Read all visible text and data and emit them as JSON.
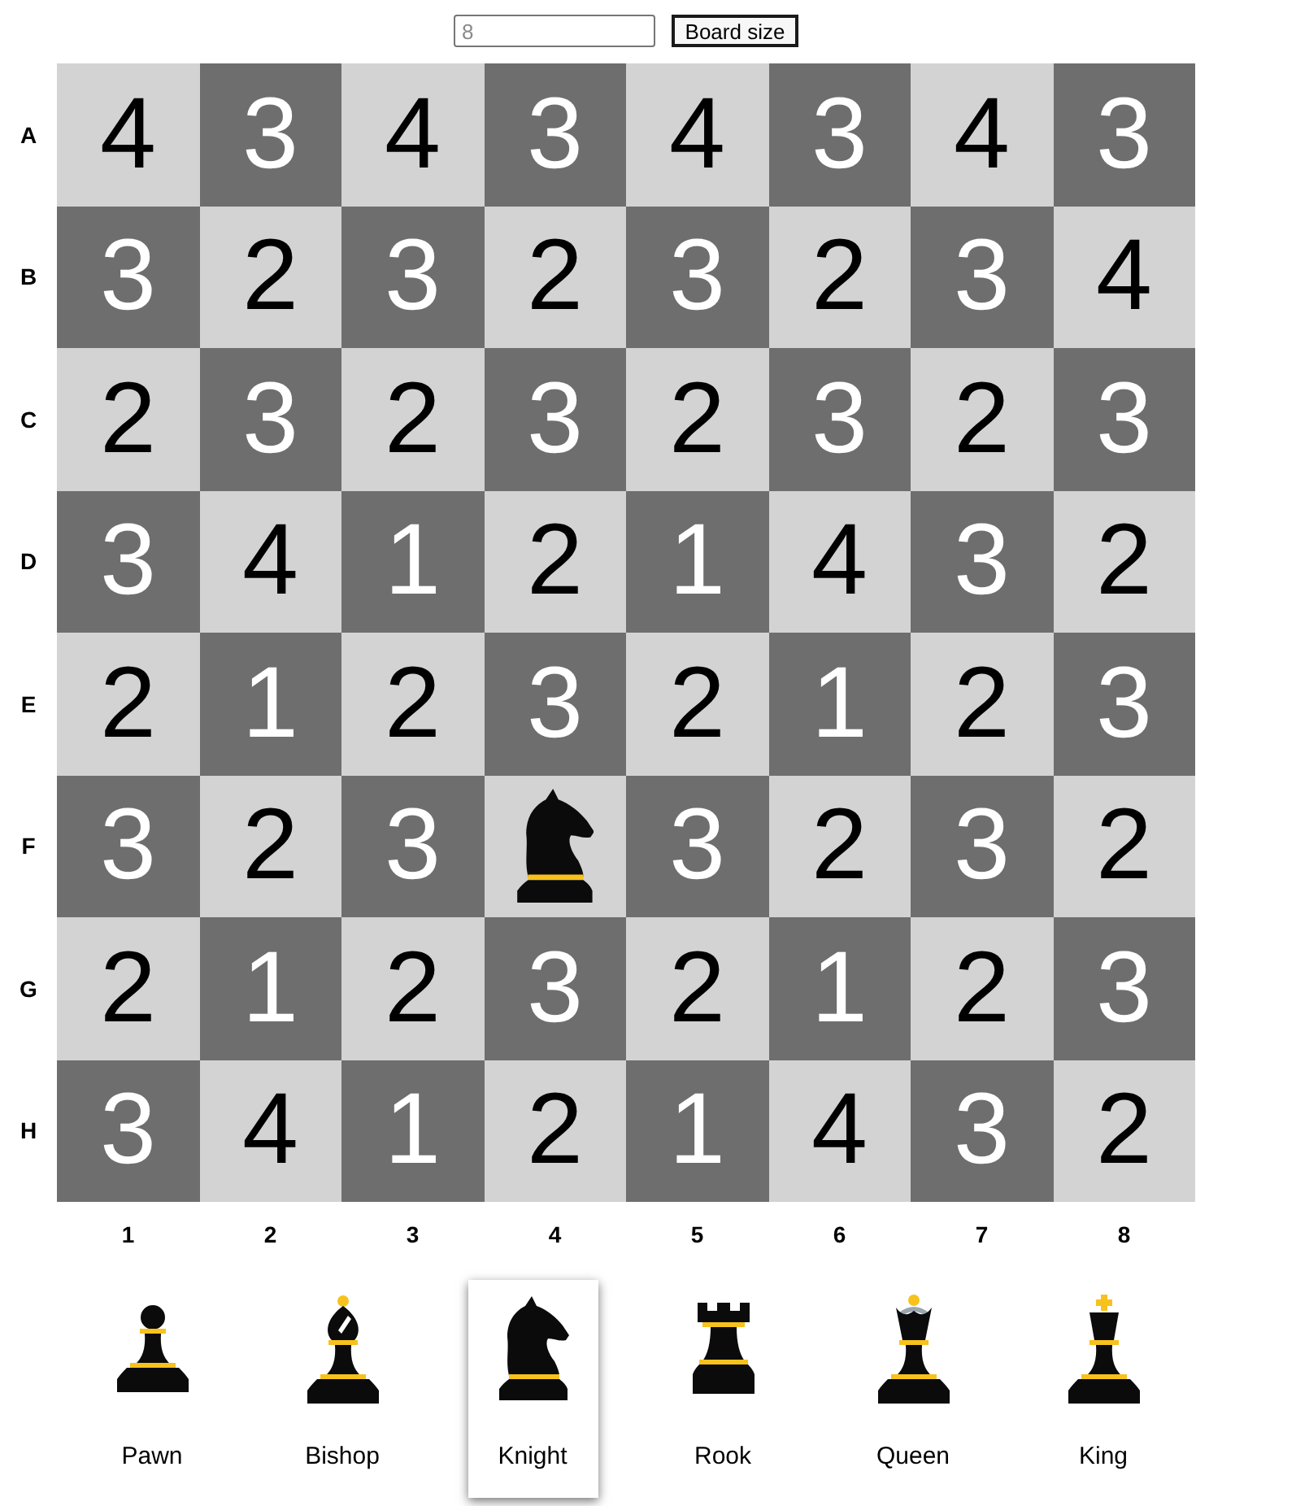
{
  "board_size_field": {
    "placeholder": "8"
  },
  "board_size_button": {
    "label": "Board size"
  },
  "board": {
    "rows": [
      {
        "label": "A",
        "cells": [
          {
            "kind": "number",
            "value": "4"
          },
          {
            "kind": "number",
            "value": "3"
          },
          {
            "kind": "number",
            "value": "4"
          },
          {
            "kind": "number",
            "value": "3"
          },
          {
            "kind": "number",
            "value": "4"
          },
          {
            "kind": "number",
            "value": "3"
          },
          {
            "kind": "number",
            "value": "4"
          },
          {
            "kind": "number",
            "value": "3"
          }
        ]
      },
      {
        "label": "B",
        "cells": [
          {
            "kind": "number",
            "value": "3"
          },
          {
            "kind": "number",
            "value": "2"
          },
          {
            "kind": "number",
            "value": "3"
          },
          {
            "kind": "number",
            "value": "2"
          },
          {
            "kind": "number",
            "value": "3"
          },
          {
            "kind": "number",
            "value": "2"
          },
          {
            "kind": "number",
            "value": "3"
          },
          {
            "kind": "number",
            "value": "4"
          }
        ]
      },
      {
        "label": "C",
        "cells": [
          {
            "kind": "number",
            "value": "2"
          },
          {
            "kind": "number",
            "value": "3"
          },
          {
            "kind": "number",
            "value": "2"
          },
          {
            "kind": "number",
            "value": "3"
          },
          {
            "kind": "number",
            "value": "2"
          },
          {
            "kind": "number",
            "value": "3"
          },
          {
            "kind": "number",
            "value": "2"
          },
          {
            "kind": "number",
            "value": "3"
          }
        ]
      },
      {
        "label": "D",
        "cells": [
          {
            "kind": "number",
            "value": "3"
          },
          {
            "kind": "number",
            "value": "4"
          },
          {
            "kind": "number",
            "value": "1"
          },
          {
            "kind": "number",
            "value": "2"
          },
          {
            "kind": "number",
            "value": "1"
          },
          {
            "kind": "number",
            "value": "4"
          },
          {
            "kind": "number",
            "value": "3"
          },
          {
            "kind": "number",
            "value": "2"
          }
        ]
      },
      {
        "label": "E",
        "cells": [
          {
            "kind": "number",
            "value": "2"
          },
          {
            "kind": "number",
            "value": "1"
          },
          {
            "kind": "number",
            "value": "2"
          },
          {
            "kind": "number",
            "value": "3"
          },
          {
            "kind": "number",
            "value": "2"
          },
          {
            "kind": "number",
            "value": "1"
          },
          {
            "kind": "number",
            "value": "2"
          },
          {
            "kind": "number",
            "value": "3"
          }
        ]
      },
      {
        "label": "F",
        "cells": [
          {
            "kind": "number",
            "value": "3"
          },
          {
            "kind": "number",
            "value": "2"
          },
          {
            "kind": "number",
            "value": "3"
          },
          {
            "kind": "knight"
          },
          {
            "kind": "number",
            "value": "3"
          },
          {
            "kind": "number",
            "value": "2"
          },
          {
            "kind": "number",
            "value": "3"
          },
          {
            "kind": "number",
            "value": "2"
          }
        ]
      },
      {
        "label": "G",
        "cells": [
          {
            "kind": "number",
            "value": "2"
          },
          {
            "kind": "number",
            "value": "1"
          },
          {
            "kind": "number",
            "value": "2"
          },
          {
            "kind": "number",
            "value": "3"
          },
          {
            "kind": "number",
            "value": "2"
          },
          {
            "kind": "number",
            "value": "1"
          },
          {
            "kind": "number",
            "value": "2"
          },
          {
            "kind": "number",
            "value": "3"
          }
        ]
      },
      {
        "label": "H",
        "cells": [
          {
            "kind": "number",
            "value": "3"
          },
          {
            "kind": "number",
            "value": "4"
          },
          {
            "kind": "number",
            "value": "1"
          },
          {
            "kind": "number",
            "value": "2"
          },
          {
            "kind": "number",
            "value": "1"
          },
          {
            "kind": "number",
            "value": "4"
          },
          {
            "kind": "number",
            "value": "3"
          },
          {
            "kind": "number",
            "value": "2"
          }
        ]
      }
    ],
    "column_labels": [
      "1",
      "2",
      "3",
      "4",
      "5",
      "6",
      "7",
      "8"
    ]
  },
  "pieces": [
    {
      "kind": "pawn",
      "label": "Pawn",
      "selected": false
    },
    {
      "kind": "bishop",
      "label": "Bishop",
      "selected": false
    },
    {
      "kind": "knight",
      "label": "Knight",
      "selected": true
    },
    {
      "kind": "rook",
      "label": "Rook",
      "selected": false
    },
    {
      "kind": "queen",
      "label": "Queen",
      "selected": false
    },
    {
      "kind": "king",
      "label": "King",
      "selected": false
    }
  ]
}
